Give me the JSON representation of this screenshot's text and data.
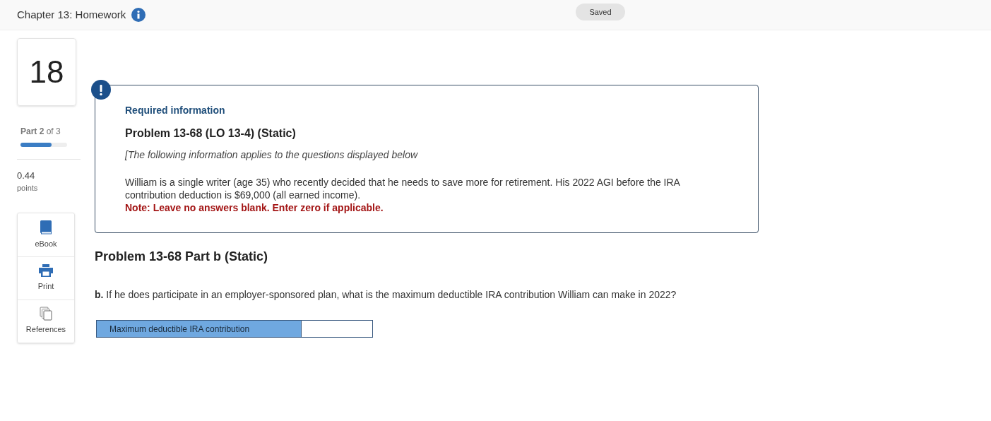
{
  "header": {
    "title": "Chapter 13: Homework",
    "status": "Saved"
  },
  "sidebar": {
    "question_number": "18",
    "part": "**Part 2** of 3",
    "progress": {
      "level": 0.67
    },
    "points": "0.44",
    "points_label": "points",
    "tools": [
      {
        "kind": "ebook",
        "label": "eBook"
      },
      {
        "kind": "print",
        "label": "Print"
      },
      {
        "kind": "references",
        "label": "References"
      }
    ]
  },
  "info_box": {
    "heading": "Required information",
    "title": "Problem 13-68 (LO 13-4) (Static)",
    "intro": "[The following information applies to the questions displayed below",
    "body": "William is a single writer (age 35) who recently decided that he needs to save more for retirement. His 2022 AGI before the IRA contribution deduction is $69,000 (all earned income).",
    "note": "Note: Leave no answers blank. Enter zero if applicable."
  },
  "part_title": "Problem 13-68 Part b (Static)",
  "question": "**b.** If he does participate in an employer-sponsored plan, what is the maximum deductible IRA contribution William can make in 2022?",
  "answer_table": {
    "label": "Maximum deductible IRA contribution"
  }
}
